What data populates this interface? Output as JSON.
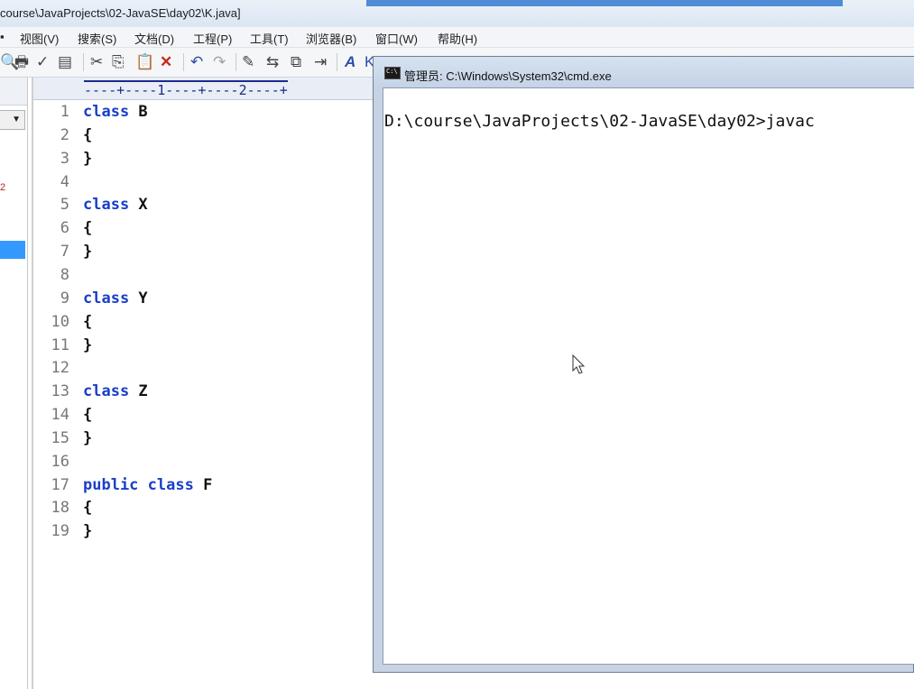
{
  "editor": {
    "title": "course\\JavaProjects\\02-JavaSE\\day02\\K.java]",
    "menus": [
      {
        "label": "视图(V)"
      },
      {
        "label": "搜索(S)"
      },
      {
        "label": "文档(D)"
      },
      {
        "label": "工程(P)"
      },
      {
        "label": "工具(T)"
      },
      {
        "label": "浏览器(B)"
      },
      {
        "label": "窗口(W)"
      },
      {
        "label": "帮助(H)"
      }
    ],
    "ruler": "----+----1----+----2----+",
    "lines": [
      {
        "num": "1",
        "kw": "class",
        "rest": " B"
      },
      {
        "num": "2",
        "kw": "",
        "rest": "{"
      },
      {
        "num": "3",
        "kw": "",
        "rest": "}"
      },
      {
        "num": "4",
        "kw": "",
        "rest": ""
      },
      {
        "num": "5",
        "kw": "class",
        "rest": " X"
      },
      {
        "num": "6",
        "kw": "",
        "rest": "{"
      },
      {
        "num": "7",
        "kw": "",
        "rest": "}"
      },
      {
        "num": "8",
        "kw": "",
        "rest": ""
      },
      {
        "num": "9",
        "kw": "class",
        "rest": " Y"
      },
      {
        "num": "10",
        "kw": "",
        "rest": "{"
      },
      {
        "num": "11",
        "kw": "",
        "rest": "}"
      },
      {
        "num": "12",
        "kw": "",
        "rest": ""
      },
      {
        "num": "13",
        "kw": "class",
        "rest": " Z"
      },
      {
        "num": "14",
        "kw": "",
        "rest": "{"
      },
      {
        "num": "15",
        "kw": "",
        "rest": "}"
      },
      {
        "num": "16",
        "kw": "",
        "rest": ""
      },
      {
        "num": "17",
        "kw": "public class",
        "rest": " F"
      },
      {
        "num": "18",
        "kw": "",
        "rest": "{"
      },
      {
        "num": "19",
        "kw": "",
        "rest": "}"
      }
    ],
    "keyword_color": "#1a3fc7"
  },
  "cmd": {
    "title": "管理员: C:\\Windows\\System32\\cmd.exe",
    "icon": "cmd-window-icon",
    "prompt_line": "D:\\course\\JavaProjects\\02-JavaSE\\day02>javac"
  }
}
